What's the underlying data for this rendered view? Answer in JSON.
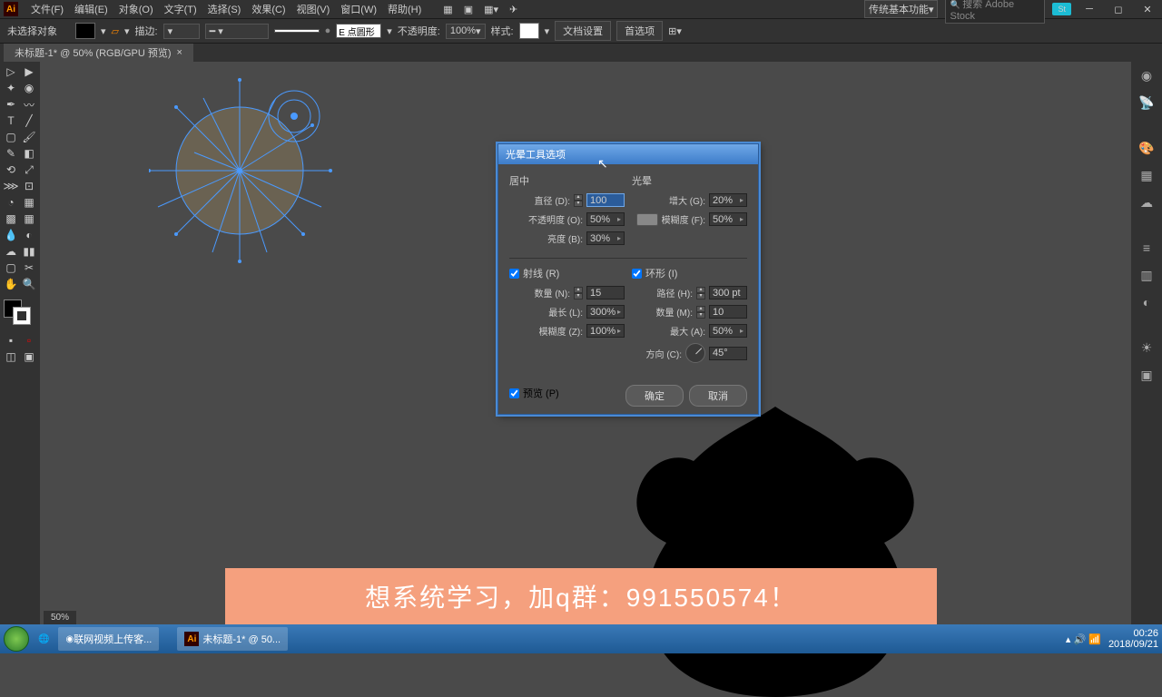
{
  "app": {
    "logo": "Ai"
  },
  "menu": [
    "文件(F)",
    "编辑(E)",
    "对象(O)",
    "文字(T)",
    "选择(S)",
    "效果(C)",
    "视图(V)",
    "窗口(W)",
    "帮助(H)"
  ],
  "workspace": "传统基本功能",
  "search_placeholder": "搜索 Adobe Stock",
  "optbar": {
    "noSelection": "未选择对象",
    "strokeLabel": "描边:",
    "shapeLabel": "E 点圆形",
    "opacityLabel": "不透明度:",
    "opacity": "100%",
    "style": "样式:",
    "docSetup": "文档设置",
    "prefs": "首选项"
  },
  "tab": {
    "title": "未标题-1* @ 50% (RGB/GPU 预览)"
  },
  "dialog": {
    "title": "光晕工具选项",
    "center": {
      "label": "居中",
      "diameter_l": "直径 (D):",
      "diameter": "100",
      "opacity_l": "不透明度 (O):",
      "opacity": "50%",
      "brightness_l": "亮度 (B):",
      "brightness": "30%"
    },
    "halo": {
      "label": "光晕",
      "growth_l": "增大 (G):",
      "growth": "20%",
      "fuzz_l": "模糊度 (F):",
      "fuzz": "50%"
    },
    "rays": {
      "label": "射线 (R)",
      "count_l": "数量 (N):",
      "count": "15",
      "longest_l": "最长 (L):",
      "longest": "300%",
      "fuzz_l": "模糊度 (Z):",
      "fuzz": "100%"
    },
    "rings": {
      "label": "环形 (I)",
      "path_l": "路径 (H):",
      "path": "300 pt",
      "count_l": "数量 (M):",
      "count": "10",
      "largest_l": "最大 (A):",
      "largest": "50%",
      "direction_l": "方向 (C):",
      "direction": "45°"
    },
    "preview": "预览 (P)",
    "ok": "确定",
    "cancel": "取消"
  },
  "banner": "想系统学习，加q群：991550574！",
  "zoom": "50%",
  "taskbar": {
    "app1": "联网视频上传客...",
    "app2": "未标题-1* @ 50...",
    "time": "00:26",
    "date": "2018/09/21"
  }
}
